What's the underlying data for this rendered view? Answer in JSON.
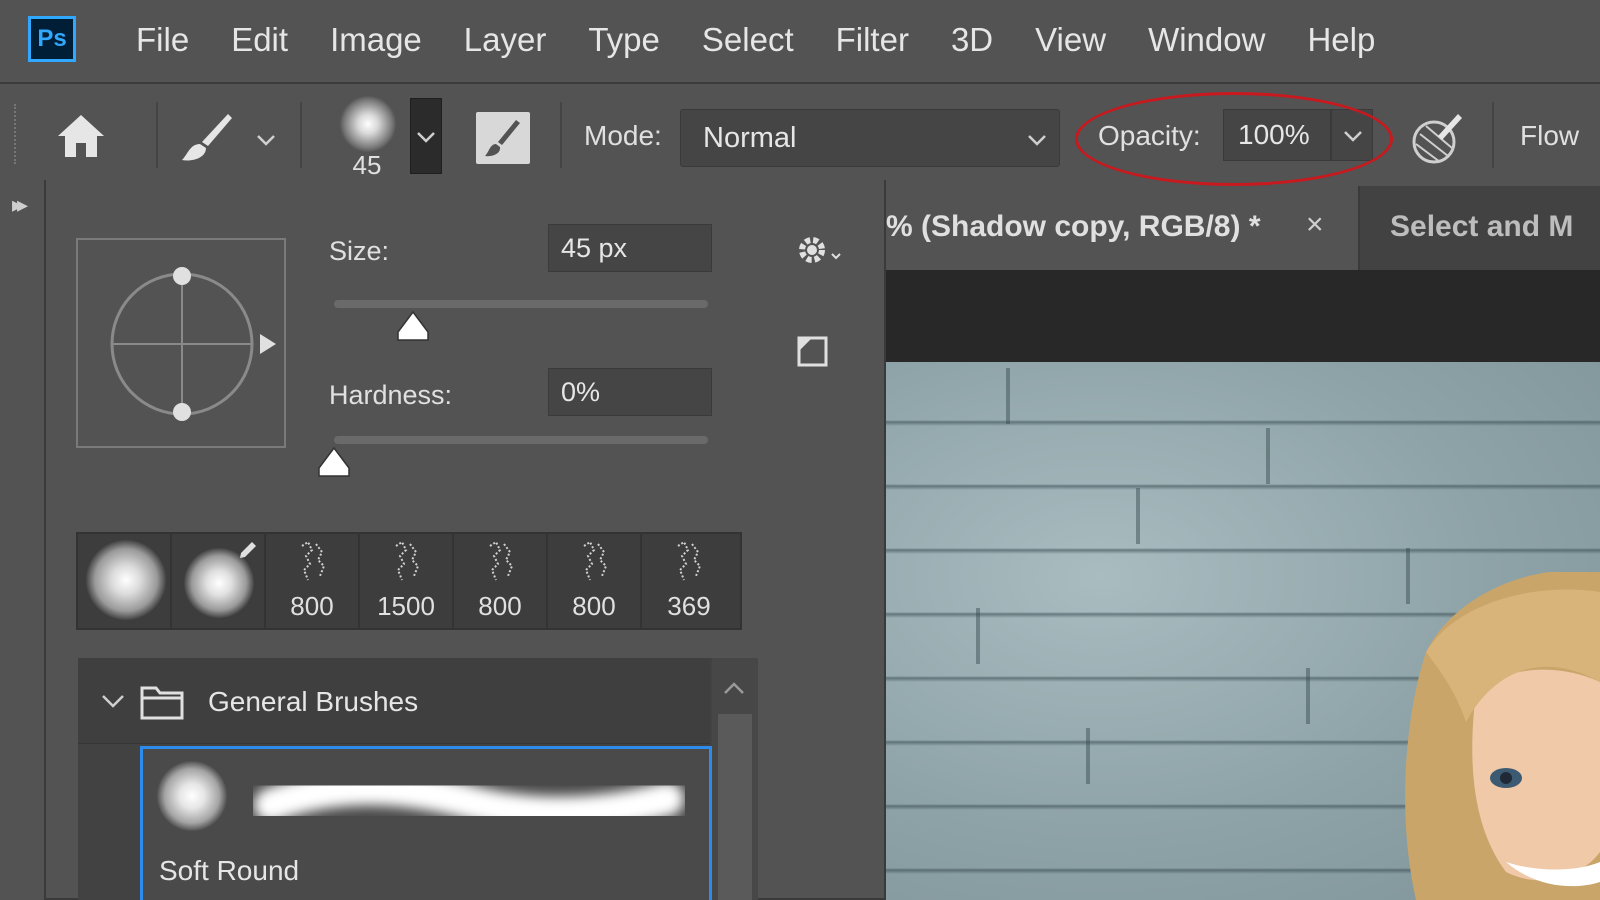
{
  "app": {
    "logo": "Ps"
  },
  "menu": {
    "items": [
      "File",
      "Edit",
      "Image",
      "Layer",
      "Type",
      "Select",
      "Filter",
      "3D",
      "View",
      "Window",
      "Help"
    ]
  },
  "options": {
    "brush_size": "45",
    "mode_label": "Mode:",
    "mode_value": "Normal",
    "opacity_label": "Opacity:",
    "opacity_value": "100%",
    "flow_label": "Flow"
  },
  "annotation": {
    "color": "#c8191e"
  },
  "tabs": [
    {
      "title": "% (Shadow copy, RGB/8) *",
      "close": "×"
    },
    {
      "title": "Select and M"
    }
  ],
  "picker": {
    "size_label": "Size:",
    "size_value": "45 px",
    "size_slider_fraction": 0.21,
    "hardness_label": "Hardness:",
    "hardness_value": "0%",
    "hardness_slider_fraction": 0.0,
    "recent_brushes": [
      {
        "kind": "soft",
        "label": ""
      },
      {
        "kind": "soft-edited",
        "label": ""
      },
      {
        "kind": "scatter",
        "label": "800"
      },
      {
        "kind": "scatter",
        "label": "1500"
      },
      {
        "kind": "scatter",
        "label": "800"
      },
      {
        "kind": "scatter",
        "label": "800"
      },
      {
        "kind": "scatter",
        "label": "369"
      }
    ],
    "folder_label": "General Brushes",
    "selected_preset": "Soft Round",
    "accent_color": "#2d8ceb"
  }
}
